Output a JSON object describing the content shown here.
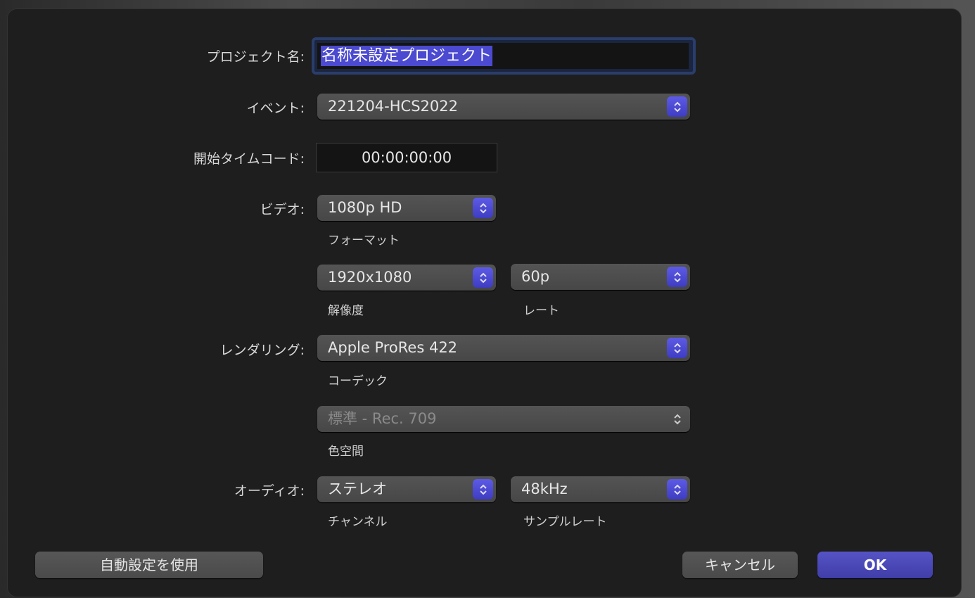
{
  "project_name": {
    "label": "プロジェクト名:",
    "value": "名称未設定プロジェクト"
  },
  "event": {
    "label": "イベント:",
    "value": "221204-HCS2022"
  },
  "timecode": {
    "label": "開始タイムコード:",
    "value": "00:00:00:00"
  },
  "video": {
    "label": "ビデオ:",
    "format": "1080p HD",
    "format_caption": "フォーマット",
    "resolution": "1920x1080",
    "resolution_caption": "解像度",
    "rate": "60p",
    "rate_caption": "レート"
  },
  "rendering": {
    "label": "レンダリング:",
    "codec": "Apple ProRes 422",
    "codec_caption": "コーデック",
    "color_space": "標準 - Rec. 709",
    "color_space_caption": "色空間"
  },
  "audio": {
    "label": "オーディオ:",
    "channels": "ステレオ",
    "channels_caption": "チャンネル",
    "sample_rate": "48kHz",
    "sample_rate_caption": "サンプルレート"
  },
  "buttons": {
    "auto": "自動設定を使用",
    "cancel": "キャンセル",
    "ok": "OK"
  },
  "colors": {
    "accent": "#4b4ad0",
    "dialog_bg": "#1e1e1e"
  }
}
